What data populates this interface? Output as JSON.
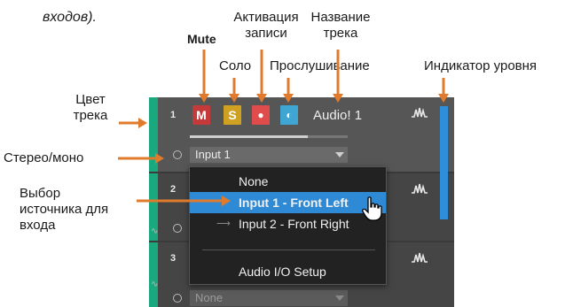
{
  "annotations": {
    "top_fragment": "входов).",
    "mute": "Mute",
    "record_line1": "Активация",
    "record_line2": "записи",
    "name_line1": "Название",
    "name_line2": "трека",
    "solo": "Соло",
    "monitor": "Прослушивание",
    "level_meter": "Индикатор уровня",
    "color_line1": "Цвет",
    "color_line2": "трека",
    "stereo_mono": "Стерео/моно",
    "source_line1": "Выбор",
    "source_line2": "источника для",
    "source_line3": "входа"
  },
  "tracks": [
    {
      "number": "1",
      "name": "Audio! 1",
      "input": "Input 1"
    },
    {
      "number": "2"
    },
    {
      "number": "3",
      "input": "None"
    }
  ],
  "buttons": {
    "mute": "M",
    "solo": "S",
    "record": "●",
    "monitor": "◐"
  },
  "colors": {
    "accent_arrow": "#e07a2c",
    "track_color": "#1aa87e",
    "mute": "#c43a3a",
    "solo": "#d0a020",
    "record": "#e04b4b",
    "monitor": "#3fa6d3",
    "highlight": "#2f8ad6"
  },
  "dropdown": {
    "items": [
      "None",
      "Input 1 - Front Left",
      "Input 2 - Front Right",
      "Audio I/O Setup"
    ],
    "selected": "Input 1 - Front Left"
  },
  "icons": [
    "waveform-icon",
    "mono-stereo-icon",
    "dropdown-chevron-icon",
    "hand-cursor-icon"
  ]
}
